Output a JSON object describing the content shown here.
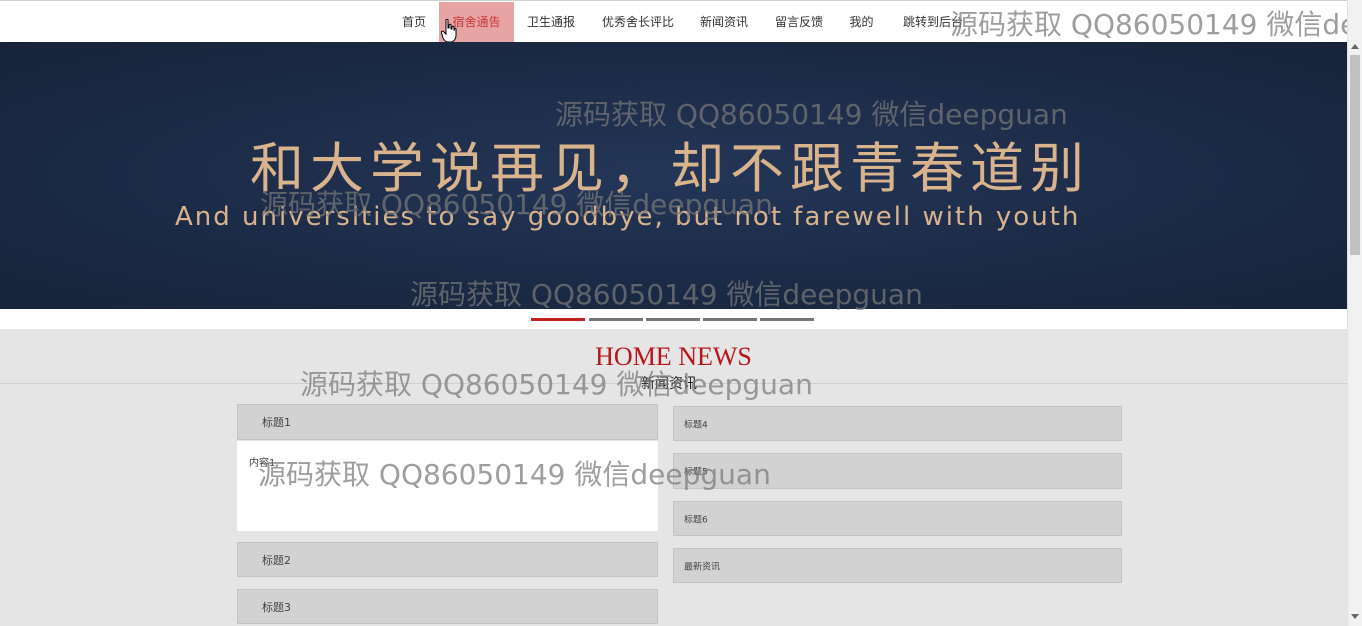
{
  "nav": {
    "items": [
      "首页",
      "宿舍通告",
      "卫生通报",
      "优秀舍长评比",
      "新闻资讯",
      "留言反馈",
      "我的",
      "跳转到后台"
    ],
    "active_index": 1
  },
  "banner": {
    "headline": "和大学说再见，却不跟青春道别",
    "subline": "And universities to say goodbye, but not farewell with youth",
    "slide_count": 5,
    "active_slide": 0
  },
  "section": {
    "title": "HOME NEWS",
    "subtitle": "新闻资讯"
  },
  "news_left": [
    {
      "title": "标题1",
      "content": "内容1"
    },
    {
      "title": "标题2"
    },
    {
      "title": "标题3"
    }
  ],
  "news_right": [
    "标题4",
    "标题5",
    "标题6",
    "最新资讯"
  ],
  "watermark": "源码获取 QQ86050149 微信deepguan",
  "colors": {
    "active_nav_bg": "#e8a4a4",
    "accent_red": "#b8141a",
    "banner_bg": "#1c2c48",
    "banner_text": "#d9b38c"
  }
}
